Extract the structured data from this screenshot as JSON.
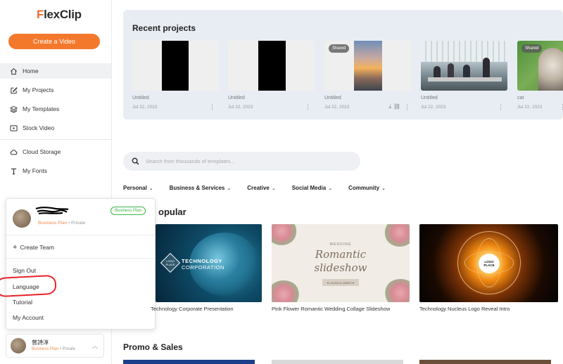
{
  "app": {
    "logo_icon": "F",
    "logo_rest": "lexClip"
  },
  "sidebar": {
    "create_button": "Create a Video",
    "items": [
      {
        "label": "Home",
        "icon": "home-icon"
      },
      {
        "label": "My Projects",
        "icon": "edit-icon"
      },
      {
        "label": "My Templates",
        "icon": "layers-icon"
      },
      {
        "label": "Stock Video",
        "icon": "video-icon"
      },
      {
        "label": "Cloud Storage",
        "icon": "cloud-icon"
      },
      {
        "label": "My Fonts",
        "icon": "font-icon"
      }
    ]
  },
  "popup": {
    "plan_badge": "Business Plan",
    "plan_text": "Business Plan",
    "privacy": " • Private",
    "create_team": "Create Team",
    "menu": [
      "Sign Out",
      "Language",
      "Tutorial",
      "My Account"
    ]
  },
  "user": {
    "name": "曾詩淳",
    "plan": "Business Plan",
    "privacy": " • Private"
  },
  "recent": {
    "title": "Recent projects",
    "shared_label": "Shared",
    "cards": [
      {
        "title": "Untitled",
        "date": "Jul 22, 2023"
      },
      {
        "title": "Untitled",
        "date": "Jul 22, 2023"
      },
      {
        "title": "Untitled",
        "date": "Jul 22, 2023"
      },
      {
        "title": "Untitled",
        "date": "Jul 22, 2023"
      },
      {
        "title": "cat",
        "date": "Jul 22, 2023"
      }
    ]
  },
  "search": {
    "placeholder": "Search from thousands of templates..."
  },
  "categories": [
    "Personal",
    "Business & Services",
    "Creative",
    "Social Media",
    "Community"
  ],
  "popular": {
    "title": "opular",
    "templates": [
      {
        "label": "Technology Corporate Presentation",
        "line1": "TECHNOLOGY",
        "line2": "CORPORATION",
        "logo": "LOGO PLACE"
      },
      {
        "label": "Pink Flower Romantic Wedding Collage Slideshow",
        "line0": "WEDDING",
        "line1": "Romantic",
        "line2": "slideshow",
        "names": "♥ LAURA & JAMES ♥"
      },
      {
        "label": "Technology Nucleus Logo Reveal Intro",
        "logo": "LOGO PLACE"
      }
    ]
  },
  "promo": {
    "title": "Promo & Sales"
  }
}
